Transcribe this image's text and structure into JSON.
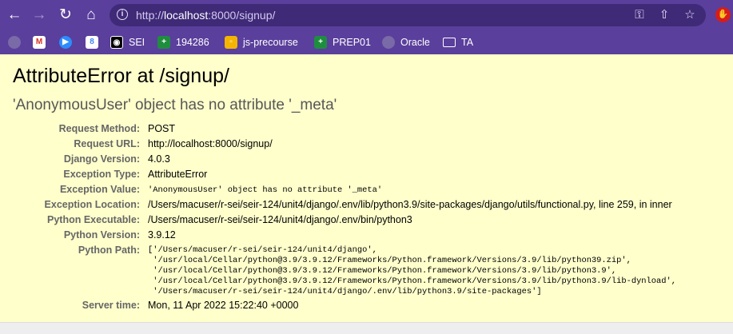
{
  "browser": {
    "url_prefix": "http://",
    "url_host": "localhost",
    "url_rest": ":8000/signup/",
    "icons": [
      "back-icon",
      "forward-icon",
      "reload-icon",
      "home-icon",
      "info-icon",
      "key-icon",
      "share-icon",
      "star-icon",
      "extension-icon"
    ]
  },
  "bookmarks": [
    {
      "label": "",
      "icon": "globe-icon",
      "color": "#7a6aa8"
    },
    {
      "label": "",
      "icon": "gmail-icon",
      "color": "#ffffff"
    },
    {
      "label": "",
      "icon": "zoom-icon",
      "color": "#2d8cff"
    },
    {
      "label": "",
      "icon": "calendar-icon",
      "color": "#4285f4"
    },
    {
      "label": "SEI",
      "icon": "sei-icon",
      "color": "#000000"
    },
    {
      "label": "194286",
      "icon": "plus-icon",
      "color": "#1e8e3e"
    },
    {
      "label": "js-precourse",
      "icon": "folder-note-icon",
      "color": "#f5b400"
    },
    {
      "label": "PREP01",
      "icon": "plus-icon",
      "color": "#1e8e3e"
    },
    {
      "label": "Oracle",
      "icon": "globe-icon",
      "color": "#7a6aa8"
    },
    {
      "label": "TA",
      "icon": "folder-icon",
      "color": "#ffffff"
    }
  ],
  "error": {
    "title": "AttributeError at /signup/",
    "message": "'AnonymousUser' object has no attribute '_meta'",
    "fields": [
      {
        "key": "Request Method:",
        "value": "POST"
      },
      {
        "key": "Request URL:",
        "value": "http://localhost:8000/signup/"
      },
      {
        "key": "Django Version:",
        "value": "4.0.3"
      },
      {
        "key": "Exception Type:",
        "value": "AttributeError"
      },
      {
        "key": "Exception Value:",
        "value": "'AnonymousUser' object has no attribute '_meta'"
      },
      {
        "key": "Exception Location:",
        "value": "/Users/macuser/r-sei/seir-124/unit4/django/.env/lib/python3.9/site-packages/django/utils/functional.py, line 259, in inner"
      },
      {
        "key": "Python Executable:",
        "value": "/Users/macuser/r-sei/seir-124/unit4/django/.env/bin/python3"
      },
      {
        "key": "Python Version:",
        "value": "3.9.12"
      },
      {
        "key": "Python Path:",
        "lines": [
          "['/Users/macuser/r-sei/seir-124/unit4/django',",
          " '/usr/local/Cellar/python@3.9/3.9.12/Frameworks/Python.framework/Versions/3.9/lib/python39.zip',",
          " '/usr/local/Cellar/python@3.9/3.9.12/Frameworks/Python.framework/Versions/3.9/lib/python3.9',",
          " '/usr/local/Cellar/python@3.9/3.9.12/Frameworks/Python.framework/Versions/3.9/lib/python3.9/lib-dynload',",
          " '/Users/macuser/r-sei/seir-124/unit4/django/.env/lib/python3.9/site-packages']"
        ]
      },
      {
        "key": "Server time:",
        "value": "Mon, 11 Apr 2022 15:22:40 +0000"
      }
    ]
  }
}
